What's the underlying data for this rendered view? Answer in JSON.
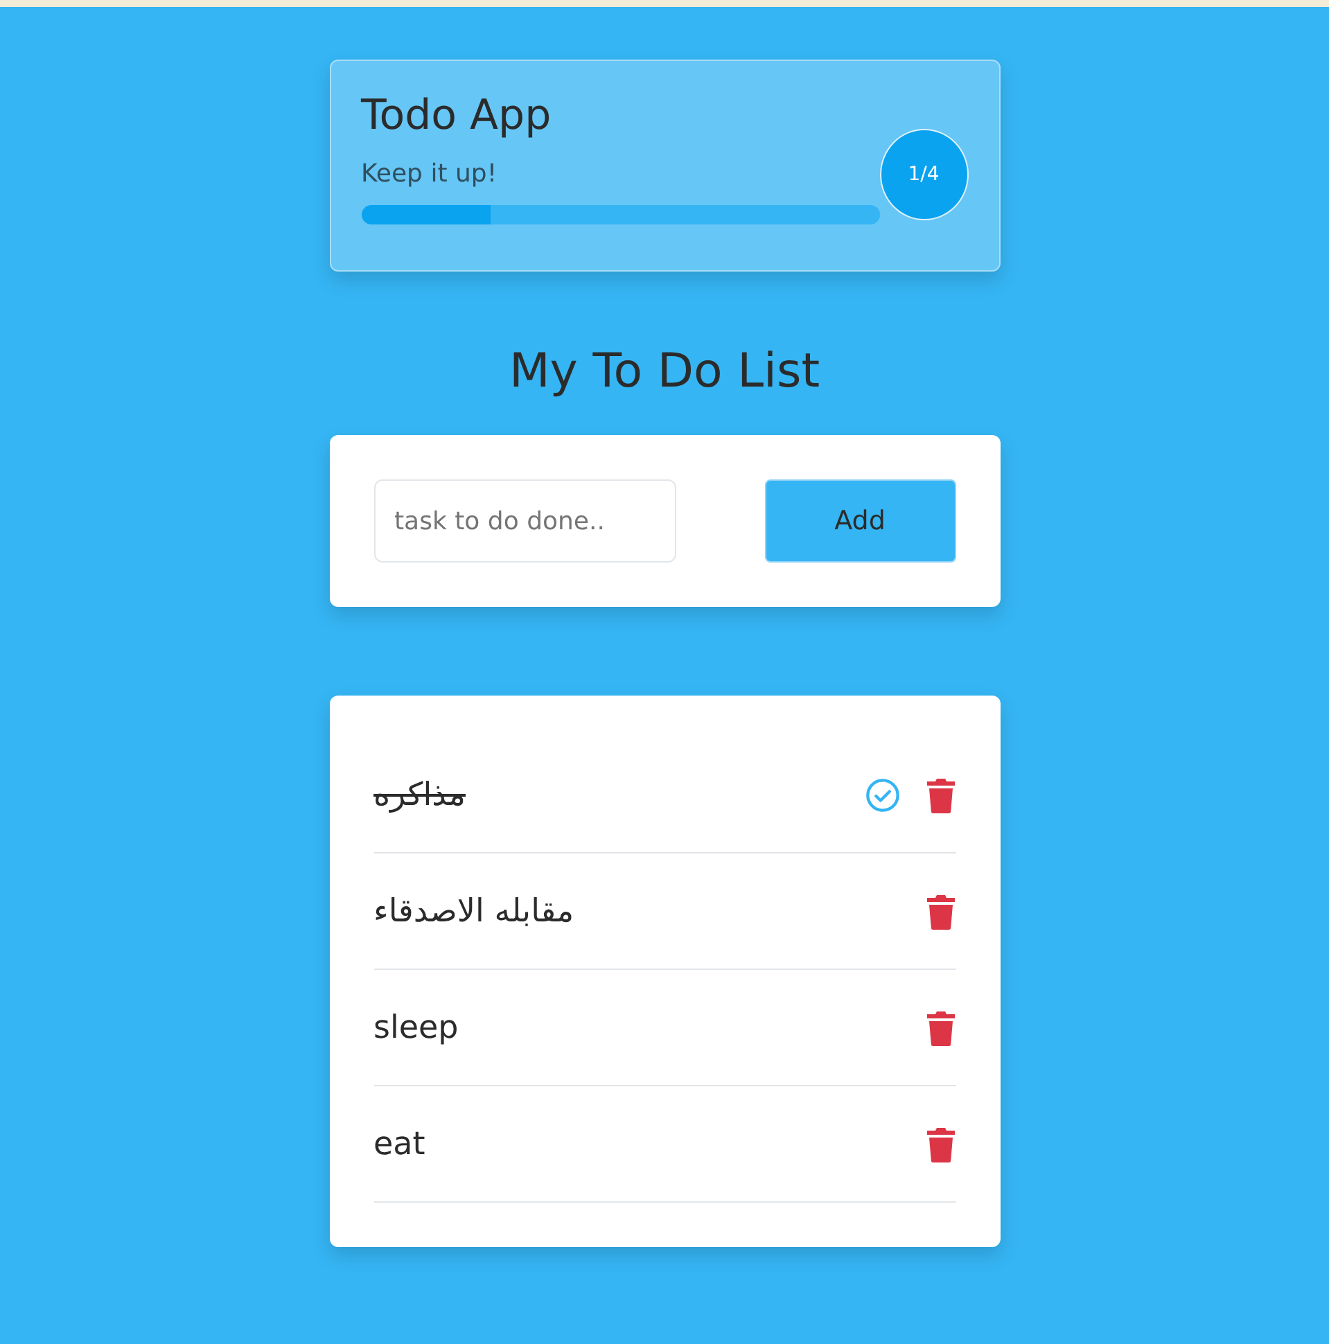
{
  "header": {
    "title": "Todo App",
    "message": "Keep it up!",
    "progress": {
      "level": 0.25
    },
    "count": "1/4"
  },
  "heading": "My To Do List",
  "form": {
    "placeholder": "task to do done..",
    "button": "Add"
  },
  "tasks": [
    {
      "text": "مذاكره",
      "done": true
    },
    {
      "text": "مقابله الاصدقاء",
      "done": false
    },
    {
      "text": "sleep",
      "done": false
    },
    {
      "text": "eat",
      "done": false
    }
  ]
}
